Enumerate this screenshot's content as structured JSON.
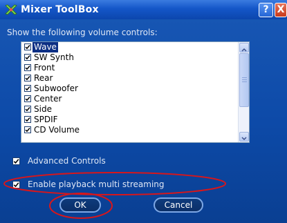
{
  "window": {
    "title": "Mixer ToolBox",
    "icon": "mixer-app-icon",
    "help_label": "?",
    "close_label": "X"
  },
  "prompt": "Show the following volume controls:",
  "controls": [
    {
      "label": "Wave",
      "checked": true,
      "selected": true
    },
    {
      "label": "SW Synth",
      "checked": true
    },
    {
      "label": "Front",
      "checked": true
    },
    {
      "label": "Rear",
      "checked": true
    },
    {
      "label": "Subwoofer",
      "checked": true
    },
    {
      "label": "Center",
      "checked": true
    },
    {
      "label": "Side",
      "checked": true
    },
    {
      "label": "SPDIF",
      "checked": true
    },
    {
      "label": "CD Volume",
      "checked": true
    }
  ],
  "options": {
    "advanced_controls": {
      "label": "Advanced Controls",
      "checked": true
    },
    "multi_streaming": {
      "label": "Enable playback multi streaming",
      "checked": true
    }
  },
  "buttons": {
    "ok": "OK",
    "cancel": "Cancel"
  },
  "colors": {
    "window_bg": "#0d4aa8",
    "titlebar": "#1456c8",
    "highlight_circle": "#d9161a",
    "selection": "#0c2f84"
  }
}
